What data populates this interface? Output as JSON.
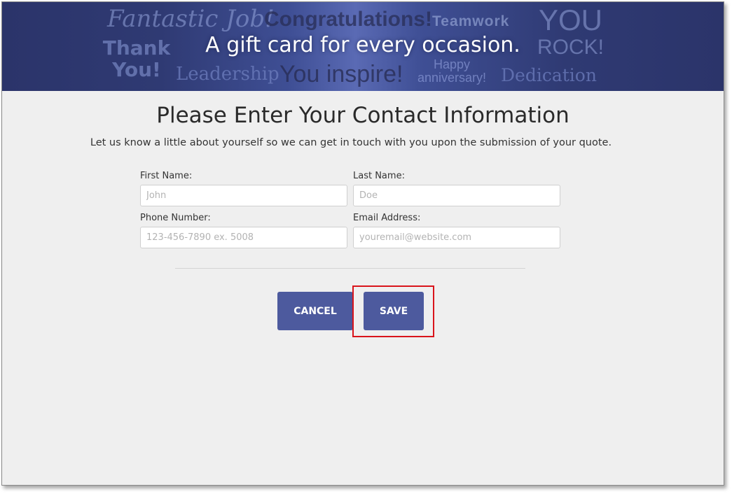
{
  "banner": {
    "headline": "A gift card for every occasion.",
    "words": [
      "Fantastic Job!",
      "Congratulations!",
      "Teamwork",
      "YOU",
      "ROCK!",
      "Thank You!",
      "Leadership",
      "You inspire!",
      "Happy anniversary!",
      "Dedication"
    ]
  },
  "page": {
    "title": "Please Enter Your Contact Information",
    "subtitle": "Let us know a little about yourself so we can get in touch with you upon the submission of your quote."
  },
  "form": {
    "first_name": {
      "label": "First Name:",
      "placeholder": "John",
      "value": ""
    },
    "last_name": {
      "label": "Last Name:",
      "placeholder": "Doe",
      "value": ""
    },
    "phone": {
      "label": "Phone Number:",
      "placeholder": "123-456-7890 ex. 5008",
      "value": ""
    },
    "email": {
      "label": "Email Address:",
      "placeholder": "youremail@website.com",
      "value": ""
    }
  },
  "actions": {
    "cancel_label": "CANCEL",
    "save_label": "SAVE"
  },
  "colors": {
    "banner": "#2f3a73",
    "button": "#4d5a9e",
    "highlight": "#d9141b",
    "background": "#efefef"
  }
}
